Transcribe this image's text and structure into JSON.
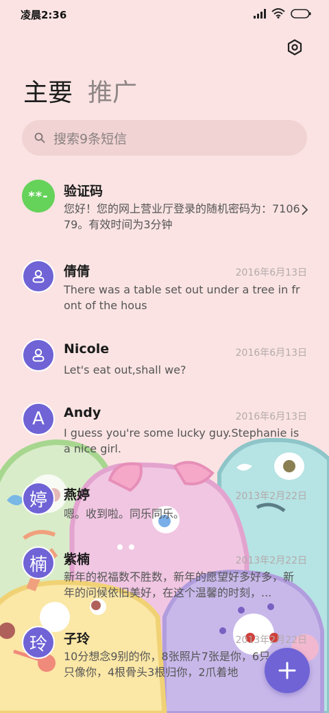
{
  "status_bar": {
    "time": "凌晨2:36",
    "icons": [
      "signal-icon",
      "wifi-icon",
      "battery-icon"
    ]
  },
  "header": {
    "settings_icon": "gear-icon"
  },
  "tabs": [
    {
      "label": "主要",
      "active": true
    },
    {
      "label": "推广",
      "active": false
    }
  ],
  "search": {
    "placeholder": "搜索9条短信"
  },
  "messages": [
    {
      "name": "验证码",
      "avatar": "**-",
      "date": "",
      "preview": "您好！您的网上营业厅登录的随机密码为：710679。有效时间为3分钟"
    },
    {
      "name": "倩倩",
      "avatar": "person-icon",
      "date": "2016年6月13日",
      "preview": "There was a table set out under a tree in front of the hous"
    },
    {
      "name": "Nicole",
      "avatar": "person-icon",
      "date": "2016年6月13日",
      "preview": "Let's eat out,shall we?"
    },
    {
      "name": "Andy",
      "avatar": "A",
      "date": "2016年6月13日",
      "preview": "I guess you're some lucky guy.Stephanie is a nice girl."
    },
    {
      "name": "燕婷",
      "avatar": "婷",
      "date": "2013年2月22日",
      "preview": "嗯。收到啦。同乐同乐。"
    },
    {
      "name": "紫楠",
      "avatar": "楠",
      "date": "2013年2月22日",
      "preview": "新年的祝福数不胜数，新年的愿望好多好多，新年的问候依旧美好，在这个温馨的时刻，..."
    },
    {
      "name": "子玲",
      "avatar": "玲",
      "date": "2013年2月22日",
      "preview": "10分想念9别的你，8张照片7张是你，6只小狗5只像你，4根骨头3根归你，2爪着地"
    }
  ],
  "fab": {
    "icon": "plus-icon"
  },
  "colors": {
    "background": "#fbe3e3",
    "accent": "#6f63d6",
    "verification_avatar": "#65d25a"
  }
}
